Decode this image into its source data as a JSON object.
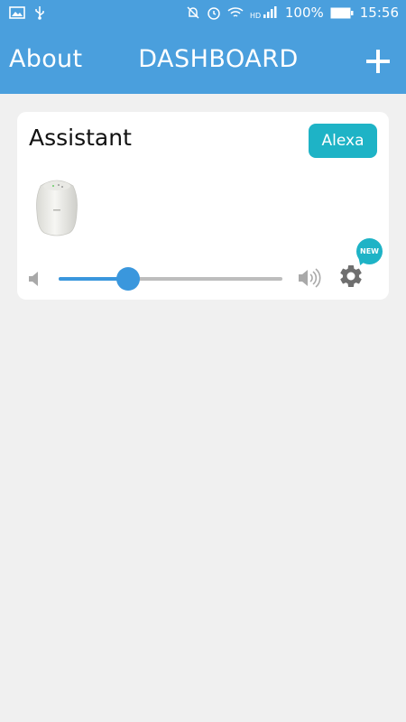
{
  "status_bar": {
    "battery_percent": "100%",
    "time": "15:56",
    "icons": [
      "image-icon",
      "usb-icon",
      "mute-icon",
      "alarm-icon",
      "wifi-icon",
      "hd-signal-icon",
      "battery-icon"
    ]
  },
  "toolbar": {
    "about_label": "About",
    "title": "DASHBOARD",
    "add_icon": "plus-icon"
  },
  "device_card": {
    "title": "Assistant",
    "alexa_button_label": "Alexa",
    "device_image": "smart-speaker-image",
    "volume_level": 0.31,
    "new_badge_label": "NEW",
    "settings_icon": "gear-icon"
  },
  "colors": {
    "primary": "#4a9fdd",
    "accent": "#1eb3c6",
    "background": "#f0f0f0",
    "card": "#ffffff"
  }
}
